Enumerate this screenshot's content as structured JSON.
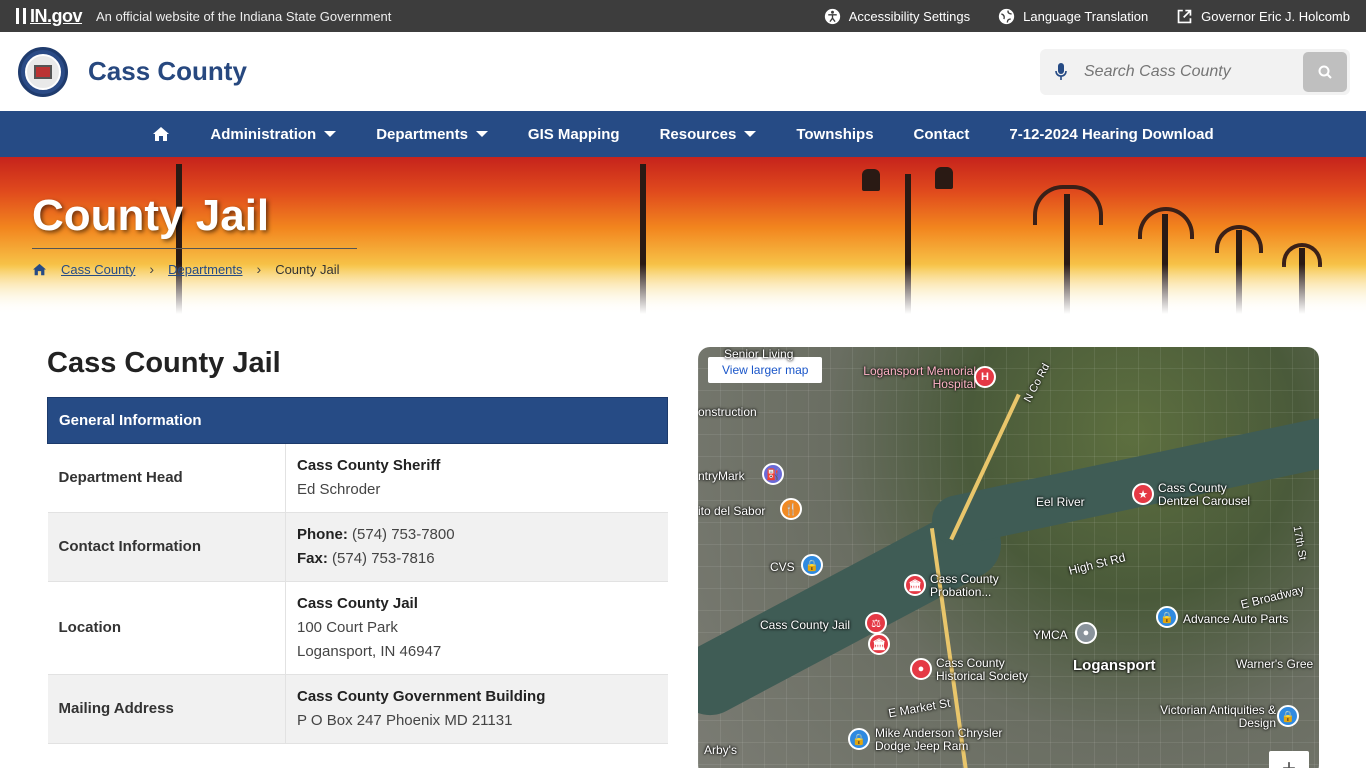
{
  "topbar": {
    "logo": "IN.gov",
    "official": "An official website of the Indiana State Government",
    "links": [
      {
        "label": "Accessibility Settings",
        "icon": "accessibility-icon"
      },
      {
        "label": "Language Translation",
        "icon": "globe-icon"
      },
      {
        "label": "Governor Eric J. Holcomb",
        "icon": "external-link-icon"
      }
    ]
  },
  "header": {
    "title": "Cass County",
    "search_placeholder": "Search Cass County"
  },
  "nav": {
    "items": [
      {
        "label": "Administration",
        "dropdown": true
      },
      {
        "label": "Departments",
        "dropdown": true
      },
      {
        "label": "GIS Mapping",
        "dropdown": false
      },
      {
        "label": "Resources",
        "dropdown": true
      },
      {
        "label": "Townships",
        "dropdown": false
      },
      {
        "label": "Contact",
        "dropdown": false
      },
      {
        "label": "7-12-2024 Hearing Download",
        "dropdown": false
      }
    ]
  },
  "hero": {
    "title": "County Jail",
    "breadcrumb": [
      "Cass County",
      "Departments",
      "County Jail"
    ]
  },
  "main": {
    "title": "Cass County Jail",
    "table_header": "General Information",
    "rows": [
      {
        "label": "Department Head",
        "lines": [
          "Cass County Sheriff",
          "Ed Schroder"
        ]
      },
      {
        "label": "Contact Information",
        "phone_label": "Phone:",
        "phone": " (574) 753-7800",
        "fax_label": "Fax:",
        "fax": " (574) 753-7816"
      },
      {
        "label": "Location",
        "lines": [
          "Cass County Jail",
          "100 Court Park",
          "Logansport, IN 46947"
        ]
      },
      {
        "label": "Mailing Address",
        "lines": [
          "Cass County Government Building",
          "P O Box 247 Phoenix MD 21131"
        ]
      }
    ]
  },
  "map": {
    "button": "View larger map",
    "labels": {
      "senior": "Senior Living",
      "hospital": "Logansport Memorial Hospital",
      "construction": "onstruction",
      "countrymark": "ntryMark",
      "sabor": "ito del Sabor",
      "river": "Eel River",
      "carousel": "Cass County Dentzel Carousel",
      "cvs": "CVS",
      "highst": "High St Rd",
      "probation": "Cass County Probation...",
      "broadway": "E Broadway",
      "jail": "Cass County Jail",
      "advance": "Advance Auto Parts",
      "ymca": "YMCA",
      "logansport": "Logansport",
      "historical": "Cass County Historical Society",
      "warners": "Warner's Gree",
      "market": "E Market St",
      "antiquities": "Victorian Antiquities & Design",
      "mike": "Mike Anderson Chrysler Dodge Jeep Ram",
      "arbys": "Arby's",
      "ncord": "N Co Rd",
      "seventeenth": "17th St"
    }
  }
}
